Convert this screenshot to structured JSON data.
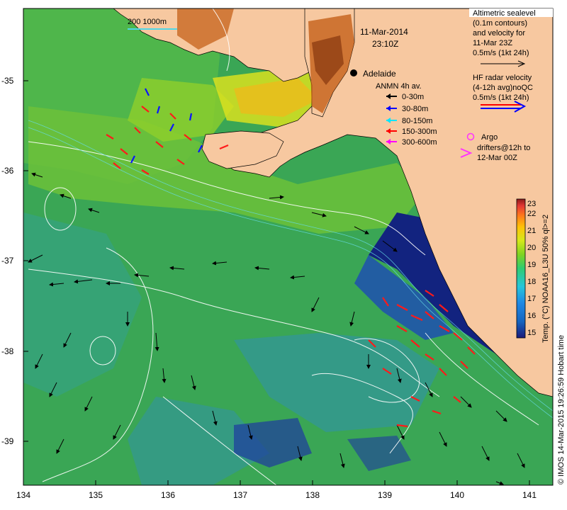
{
  "header": {
    "date": "11-Mar-2014",
    "time": "23:10Z"
  },
  "scale_bar": {
    "label": "200  1000m",
    "color": "#4fd6e6"
  },
  "place": {
    "label": "Adelaide"
  },
  "legend_sealevel": {
    "lines": [
      "Altimetric sealevel",
      "(0.1m contours)",
      "and velocity for",
      "11-Mar 23Z",
      "0.5m/s (1kt 24h)"
    ]
  },
  "legend_hf": {
    "lines": [
      "HF radar velocity",
      "(4-12h avg)noQC",
      "0.5m/s (1kt 24h)"
    ],
    "colors": [
      "#ff0000",
      "#0000ff"
    ]
  },
  "legend_anmn": {
    "title": "ANMN 4h av.",
    "items": [
      {
        "label": "0-30m",
        "color": "#000000"
      },
      {
        "label": "30-80m",
        "color": "#0000ff"
      },
      {
        "label": "80-150m",
        "color": "#00e5ff"
      },
      {
        "label": "150-300m",
        "color": "#ff0000"
      },
      {
        "label": "300-600m",
        "color": "#ff00ff"
      }
    ]
  },
  "legend_argo": {
    "lines": [
      "Argo",
      "drifters@12h to",
      "12-Mar 00Z"
    ],
    "color": "#ff33ff"
  },
  "colorbar": {
    "ticks": [
      "15",
      "16",
      "17",
      "18",
      "19",
      "20",
      "21",
      "22",
      "23"
    ],
    "label": "Temp. (°C) NOAA16_L3U 50% ql>=2",
    "colors": [
      "#1a1a7a",
      "#1565c0",
      "#1e88e5",
      "#26c6da",
      "#2ecc71",
      "#7ed321",
      "#d4e81a",
      "#ffc107",
      "#ff7a1a",
      "#e53935",
      "#8b1a1a"
    ]
  },
  "x_axis": {
    "ticks": [
      "134",
      "135",
      "136",
      "137",
      "138",
      "139",
      "140",
      "141"
    ]
  },
  "y_axis": {
    "ticks": [
      "-35",
      "-36",
      "-37",
      "-38",
      "-39"
    ]
  },
  "credit": {
    "text": "© IMOS 14-Mar-2015 19:26:59 Hobart time"
  },
  "palette": {
    "land": "#f7c8a0",
    "ocean_shelf": "#4caf50",
    "ocean_deep": "#3cb371",
    "upwelling": "#0d1a80"
  }
}
